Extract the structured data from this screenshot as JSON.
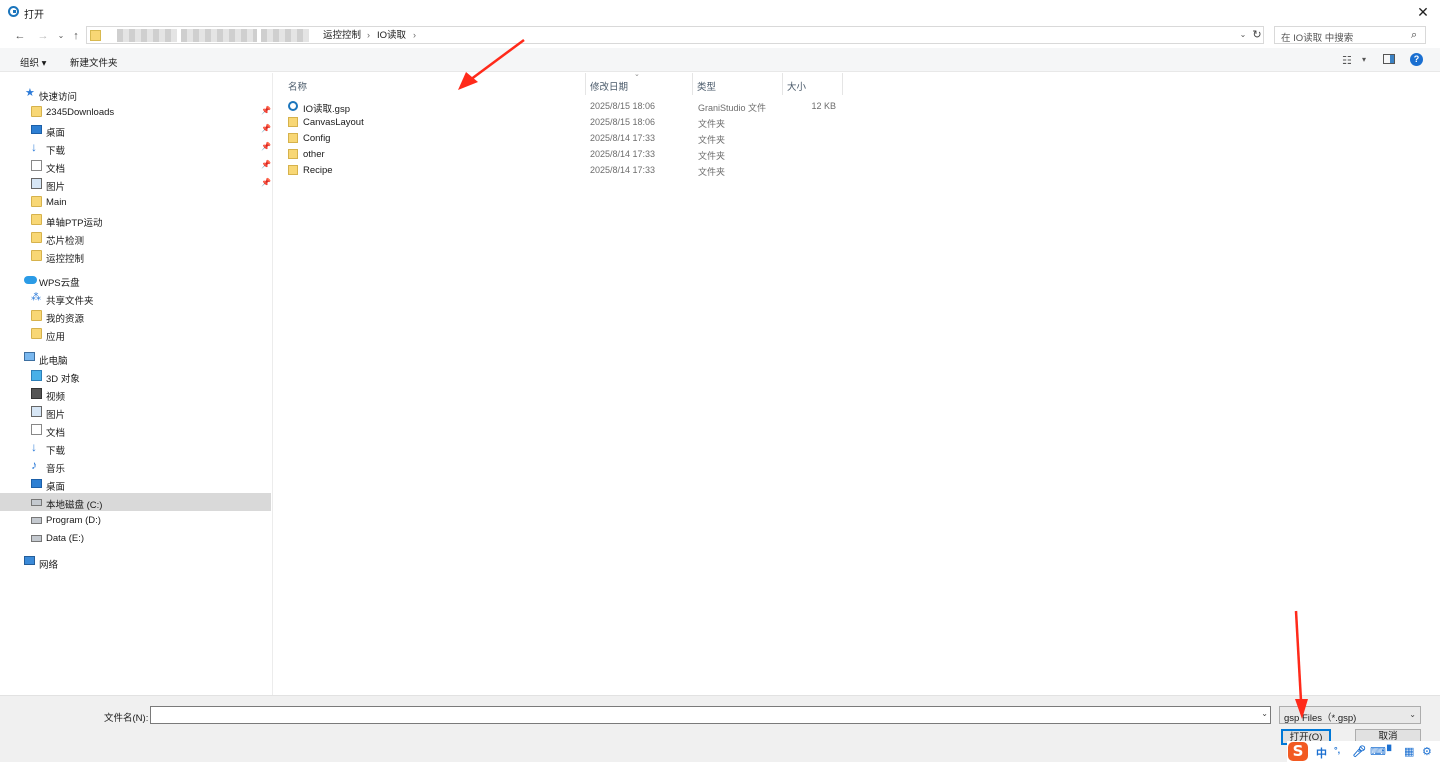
{
  "window": {
    "title": "打开"
  },
  "address": {
    "breadcrumbs": [
      "运控控制",
      "IO读取"
    ],
    "search_placeholder": "在 IO读取 中搜索"
  },
  "toolbar": {
    "organize_label": "组织 ▾",
    "new_folder_label": "新建文件夹"
  },
  "nav": {
    "quick_access": "快速访问",
    "quick_items": [
      "2345Downloads",
      "桌面",
      "下载",
      "文档",
      "图片",
      "Main",
      "单轴PTP运动",
      "芯片检测",
      "运控控制"
    ],
    "wps_cloud": "WPS云盘",
    "wps_items": [
      "共享文件夹",
      "我的资源",
      "应用"
    ],
    "this_pc": "此电脑",
    "pc_items": [
      "3D 对象",
      "视频",
      "图片",
      "文档",
      "下载",
      "音乐",
      "桌面",
      "本地磁盘 (C:)",
      "Program (D:)",
      "Data (E:)"
    ],
    "network": "网络",
    "selected": "本地磁盘 (C:)"
  },
  "columns": {
    "name": "名称",
    "modified": "修改日期",
    "type": "类型",
    "size": "大小"
  },
  "files": [
    {
      "name": "IO读取.gsp",
      "date": "2025/8/15 18:06",
      "type": "GraniStudio 文件",
      "size": "12 KB",
      "icon": "gsp-file-icon"
    },
    {
      "name": "CanvasLayout",
      "date": "2025/8/15 18:06",
      "type": "文件夹",
      "size": "",
      "icon": "folder-icon"
    },
    {
      "name": "Config",
      "date": "2025/8/14 17:33",
      "type": "文件夹",
      "size": "",
      "icon": "folder-icon"
    },
    {
      "name": "other",
      "date": "2025/8/14 17:33",
      "type": "文件夹",
      "size": "",
      "icon": "folder-icon"
    },
    {
      "name": "Recipe",
      "date": "2025/8/14 17:33",
      "type": "文件夹",
      "size": "",
      "icon": "folder-icon"
    }
  ],
  "bottom": {
    "filename_label": "文件名(N):",
    "filename_value": "",
    "filter_value": "gsp Files（*.gsp)",
    "open_label": "打开(O)",
    "cancel_label": "取消"
  },
  "ime": {
    "logo": "S",
    "lang": "中",
    "punct": "°,"
  },
  "colors": {
    "accent": "#0078d7",
    "folder": "#f8d775",
    "selection": "#d9d9d9",
    "annotation_arrow": "#ff2a1a"
  }
}
